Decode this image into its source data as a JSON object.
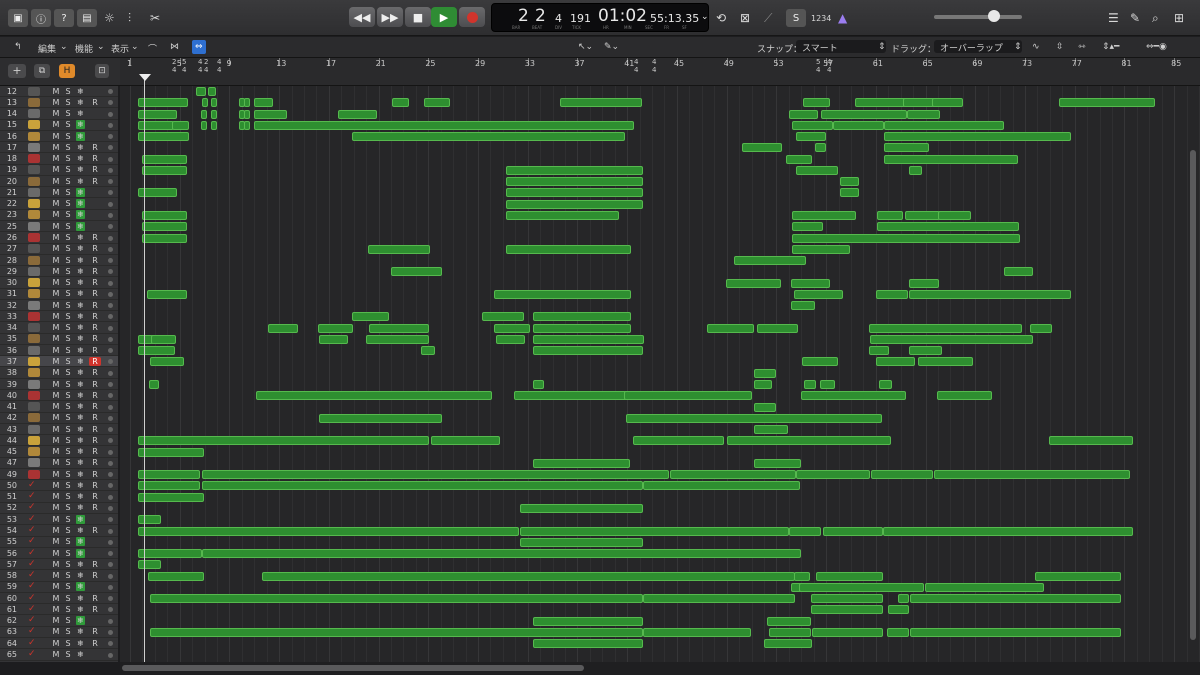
{
  "transport": {
    "bar": "2",
    "beat": "2",
    "div": "4",
    "tick": "191",
    "time": "01:02",
    "frames": "55:13.35",
    "bar_label": "BAR",
    "beat_label": "BEAT",
    "div_label": "DIV",
    "tick_label": "TICK",
    "hr_label": "HR",
    "min_label": "MIN",
    "sec_label": "SEC",
    "fr_label": "FR",
    "sf_label": "SF",
    "key_display": "1234"
  },
  "menu": {
    "edit": "編集",
    "function": "機能",
    "view": "表示",
    "snap_label": "スナップ：",
    "snap_value": "スマート",
    "drag_label": "ドラッグ：",
    "drag_value": "オーバーラップ"
  },
  "ruler": {
    "bars": [
      "1",
      "5",
      "9",
      "13",
      "17",
      "21",
      "25",
      "29",
      "33",
      "37",
      "41",
      "45",
      "49",
      "53",
      "57",
      "61",
      "65",
      "69",
      "73",
      "77",
      "81",
      "85"
    ],
    "signatures": [
      {
        "top": "2",
        "bottom": "4"
      },
      {
        "top": "5",
        "bottom": "4"
      },
      {
        "top": "4",
        "bottom": "4"
      },
      {
        "top": "2",
        "bottom": "4"
      },
      {
        "top": "4",
        "bottom": "4"
      },
      {
        "top": "4",
        "bottom": "4"
      },
      {
        "top": "4",
        "bottom": "4"
      },
      {
        "top": "5",
        "bottom": "4"
      },
      {
        "top": "4",
        "bottom": "4"
      }
    ]
  },
  "track_numbers": [
    "12",
    "13",
    "14",
    "15",
    "16",
    "17",
    "18",
    "19",
    "20",
    "21",
    "22",
    "23",
    "25",
    "26",
    "27",
    "28",
    "29",
    "30",
    "31",
    "32",
    "33",
    "34",
    "35",
    "36",
    "37",
    "38",
    "39",
    "40",
    "41",
    "42",
    "43",
    "44",
    "45",
    "47",
    "49",
    "50",
    "51",
    "52",
    "53",
    "54",
    "55",
    "56",
    "57",
    "58",
    "59",
    "60",
    "61",
    "62",
    "63",
    "64",
    "65"
  ],
  "track_button_labels": {
    "mute": "M",
    "solo": "S",
    "record": "R",
    "freeze": "❄"
  },
  "track_freeze_states": [
    "none",
    "blank",
    "none",
    "green",
    "green",
    "blank",
    "blank",
    "blank",
    "blank",
    "green",
    "green",
    "green",
    "green",
    "blank",
    "blank",
    "blank",
    "blank",
    "blank",
    "blank",
    "blank",
    "blank",
    "blank",
    "blank",
    "blank",
    "red",
    "blank",
    "blank",
    "blank",
    "blank",
    "blank",
    "blank",
    "blank",
    "blank",
    "blank",
    "blank",
    "blank",
    "blank",
    "blank",
    "green",
    "blank",
    "green",
    "green",
    "blank",
    "blank",
    "green",
    "blank",
    "blank",
    "green",
    "blank",
    "blank",
    "none"
  ],
  "colors": {
    "region": "#2e8f30",
    "region_border": "#56b94e",
    "record_active": "#d0342c",
    "freeze_green": "#2f9b3a"
  },
  "regions": [
    [
      [
        58,
        68
      ],
      [
        70,
        78
      ]
    ],
    [
      [
        0,
        50
      ],
      [
        64,
        67
      ],
      [
        73,
        79
      ],
      [
        101,
        102
      ],
      [
        106,
        108
      ],
      [
        116,
        135
      ],
      [
        254,
        271
      ],
      [
        286,
        312
      ],
      [
        422,
        504
      ],
      [
        665,
        692
      ],
      [
        717,
        785
      ],
      [
        765,
        798
      ],
      [
        794,
        825
      ],
      [
        921,
        1017
      ]
    ],
    [
      [
        0,
        39
      ],
      [
        63,
        67
      ],
      [
        73,
        79
      ],
      [
        101,
        102
      ],
      [
        106,
        108
      ],
      [
        116,
        149
      ],
      [
        200,
        239
      ],
      [
        651,
        680
      ],
      [
        683,
        769
      ],
      [
        769,
        802
      ]
    ],
    [
      [
        0,
        36
      ],
      [
        34,
        51
      ],
      [
        63,
        67
      ],
      [
        73,
        79
      ],
      [
        101,
        102
      ],
      [
        106,
        108
      ],
      [
        116,
        496
      ],
      [
        654,
        695
      ],
      [
        695,
        746
      ],
      [
        746,
        866
      ]
    ],
    [
      [
        0,
        51
      ],
      [
        214,
        487
      ],
      [
        658,
        688
      ],
      [
        746,
        933
      ]
    ],
    [
      [
        604,
        644
      ],
      [
        677,
        688
      ],
      [
        746,
        791
      ]
    ],
    [
      [
        4,
        49
      ],
      [
        648,
        674
      ],
      [
        746,
        880
      ]
    ],
    [
      [
        4,
        49
      ],
      [
        368,
        505
      ],
      [
        658,
        700
      ],
      [
        771,
        784
      ]
    ],
    [
      [
        368,
        505
      ],
      [
        702,
        721
      ]
    ],
    [
      [
        0,
        39
      ],
      [
        368,
        505
      ],
      [
        702,
        721
      ]
    ],
    [
      [
        368,
        505
      ]
    ],
    [
      [
        4,
        49
      ],
      [
        368,
        481
      ],
      [
        654,
        718
      ],
      [
        739,
        765
      ],
      [
        767,
        802
      ],
      [
        800,
        833
      ]
    ],
    [
      [
        4,
        49
      ],
      [
        654,
        685
      ],
      [
        739,
        881
      ]
    ],
    [
      [
        4,
        49
      ],
      [
        654,
        882
      ]
    ],
    [
      [
        230,
        292
      ],
      [
        368,
        493
      ],
      [
        654,
        712
      ]
    ],
    [
      [
        596,
        668
      ]
    ],
    [
      [
        253,
        304
      ],
      [
        866,
        895
      ]
    ],
    [
      [
        588,
        643
      ],
      [
        653,
        692
      ],
      [
        771,
        801
      ]
    ],
    [
      [
        9,
        49
      ],
      [
        356,
        493
      ],
      [
        656,
        705
      ],
      [
        738,
        770
      ],
      [
        771,
        933
      ]
    ],
    [
      [
        653,
        677
      ]
    ],
    [
      [
        214,
        251
      ],
      [
        344,
        386
      ],
      [
        395,
        493
      ]
    ],
    [
      [
        130,
        160
      ],
      [
        180,
        215
      ],
      [
        231,
        291
      ],
      [
        356,
        392
      ],
      [
        395,
        493
      ],
      [
        569,
        616
      ],
      [
        619,
        660
      ],
      [
        731,
        884
      ],
      [
        892,
        914
      ]
    ],
    [
      [
        0,
        22
      ],
      [
        13,
        38
      ],
      [
        181,
        210
      ],
      [
        228,
        291
      ],
      [
        358,
        387
      ],
      [
        395,
        506
      ],
      [
        732,
        895
      ]
    ],
    [
      [
        0,
        37
      ],
      [
        283,
        297
      ],
      [
        395,
        505
      ],
      [
        731,
        751
      ],
      [
        771,
        804
      ]
    ],
    [
      [
        12,
        46
      ],
      [
        664,
        700
      ],
      [
        738,
        777
      ],
      [
        780,
        835
      ]
    ],
    [
      [
        616,
        638
      ]
    ],
    [
      [
        11,
        21
      ],
      [
        395,
        406
      ],
      [
        616,
        634
      ],
      [
        666,
        678
      ],
      [
        682,
        697
      ],
      [
        741,
        754
      ]
    ],
    [
      [
        118,
        354
      ],
      [
        376,
        495
      ],
      [
        486,
        614
      ],
      [
        663,
        768
      ],
      [
        799,
        854
      ]
    ],
    [
      [
        616,
        638
      ]
    ],
    [
      [
        181,
        304
      ],
      [
        488,
        744
      ]
    ],
    [
      [
        616,
        650
      ]
    ],
    [
      [
        0,
        291
      ],
      [
        293,
        362
      ],
      [
        495,
        586
      ],
      [
        589,
        753
      ],
      [
        911,
        995
      ]
    ],
    [
      [
        0,
        66
      ]
    ],
    [
      [
        395,
        492
      ],
      [
        616,
        663
      ]
    ],
    [
      [
        0,
        62
      ],
      [
        64,
        531
      ],
      [
        532,
        658
      ],
      [
        658,
        732
      ],
      [
        733,
        795
      ],
      [
        796,
        992
      ]
    ],
    [
      [
        0,
        62
      ],
      [
        64,
        505
      ],
      [
        505,
        662
      ]
    ],
    [
      [
        0,
        66
      ]
    ],
    [
      [
        382,
        505
      ]
    ],
    [
      [
        0,
        23
      ]
    ],
    [
      [
        0,
        381
      ],
      [
        382,
        651
      ],
      [
        651,
        683
      ],
      [
        685,
        745
      ],
      [
        745,
        995
      ]
    ],
    [
      [
        382,
        505
      ]
    ],
    [
      [
        0,
        64
      ],
      [
        64,
        663
      ]
    ],
    [
      [
        0,
        23
      ]
    ],
    [
      [
        10,
        66
      ],
      [
        124,
        657
      ],
      [
        656,
        672
      ],
      [
        678,
        745
      ],
      [
        897,
        983
      ]
    ],
    [
      [
        653,
        671
      ],
      [
        661,
        786
      ],
      [
        787,
        906
      ]
    ],
    [
      [
        12,
        505
      ],
      [
        505,
        657
      ],
      [
        673,
        745
      ],
      [
        760,
        771
      ],
      [
        772,
        983
      ]
    ],
    [
      [
        673,
        745
      ],
      [
        750,
        771
      ]
    ],
    [
      [
        395,
        505
      ],
      [
        629,
        673
      ]
    ],
    [
      [
        12,
        505
      ],
      [
        505,
        613
      ],
      [
        631,
        673
      ],
      [
        674,
        745
      ],
      [
        749,
        771
      ],
      [
        772,
        983
      ]
    ],
    [
      [
        395,
        505
      ],
      [
        626,
        674
      ]
    ],
    []
  ]
}
